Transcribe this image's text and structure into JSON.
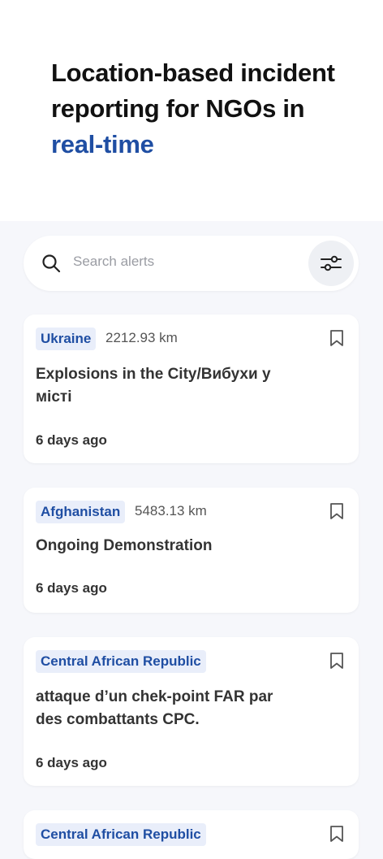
{
  "hero": {
    "title_line": "Location-based incident reporting for NGOs in",
    "title_accent": "real-time"
  },
  "search": {
    "placeholder": "Search alerts",
    "icon": "search-icon",
    "filter_icon": "sliders-icon"
  },
  "alerts": [
    {
      "country": "Ukraine",
      "distance": "2212.93 km",
      "title": "Explosions in the City/Вибухи у місті",
      "age": "6 days ago"
    },
    {
      "country": "Afghanistan",
      "distance": "5483.13 km",
      "title": "Ongoing Demonstration",
      "age": "6 days ago"
    },
    {
      "country": "Central African Republic",
      "distance": "",
      "title": "attaque d’un chek-point FAR par des combattants CPC.",
      "age": "6 days ago"
    },
    {
      "country": "Central African Republic",
      "distance": "",
      "title": "",
      "age": ""
    }
  ],
  "colors": {
    "accent": "#1f4ea3",
    "tag_bg": "#e9eefa",
    "background": "#f6f7fb"
  }
}
